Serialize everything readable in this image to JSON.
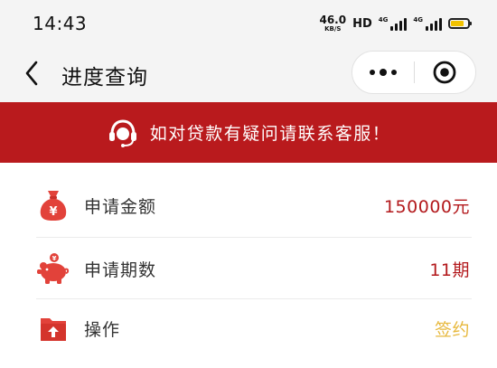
{
  "status_bar": {
    "time": "14:43",
    "net_speed": "46.0",
    "net_speed_unit": "KB/S",
    "hd_label": "HD",
    "signal_1_tag": "4G",
    "signal_2_tag": "4G",
    "battery_level": 0.8
  },
  "nav": {
    "title": "进度查询",
    "back_icon": "chevron-left-icon",
    "more_icon": "more-dots-icon",
    "close_icon": "target-circle-icon"
  },
  "banner": {
    "text": "如对贷款有疑问请联系客服！",
    "icon": "customer-service-headset-icon"
  },
  "rows": [
    {
      "label": "申请金额",
      "value": "150000元",
      "icon": "money-bag-icon"
    },
    {
      "label": "申请期数",
      "value": "11期",
      "icon": "piggy-bank-icon"
    },
    {
      "label": "操作",
      "value": "签约",
      "icon": "upload-folder-icon"
    }
  ],
  "colors": {
    "brand_red": "#b91a1d",
    "value_red": "#b3191c",
    "action_gold": "#e7b83c",
    "icon_red": "#e2423a"
  }
}
